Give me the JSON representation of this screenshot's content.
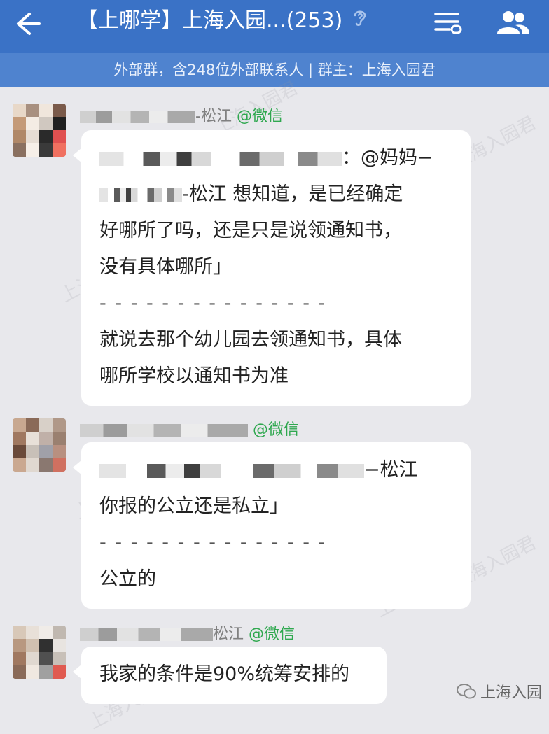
{
  "header": {
    "title": "【上哪学】上海入园...(253)",
    "subtitle": "外部群，含248位外部联系人 | 群主：上海入园君"
  },
  "watermark_text": "上海入园君",
  "messages": [
    {
      "sender_suffix": "-松江",
      "source": "@微信",
      "lines": {
        "l1_tail": "：@妈妈−",
        "l2_tail": "-松江 想知道，是已经确定",
        "l3": "好哪所了吗，还是只是说领通知书，",
        "l4": "没有具体哪所」",
        "sep": "- - - - - - - - - - - - - - -",
        "l5": "就说去那个幼儿园去领通知书，具体",
        "l6": "哪所学校以通知书为准"
      }
    },
    {
      "sender_suffix": "",
      "source": "@微信",
      "lines": {
        "l1_tail": "−松江",
        "l2": "你报的公立还是私立」",
        "sep": "- - - - - - - - - - - - - - -",
        "l3": "公立的"
      }
    },
    {
      "sender_suffix": "松江",
      "source": "@微信",
      "lines": {
        "l1": "我家的条件是90%统筹安排的"
      }
    }
  ],
  "footer": {
    "brand": "上海入园"
  },
  "colors": {
    "header": "#3a72c6",
    "subbar": "#4f83cf",
    "source_green": "#2fa84f",
    "background": "#e8e8ec"
  }
}
